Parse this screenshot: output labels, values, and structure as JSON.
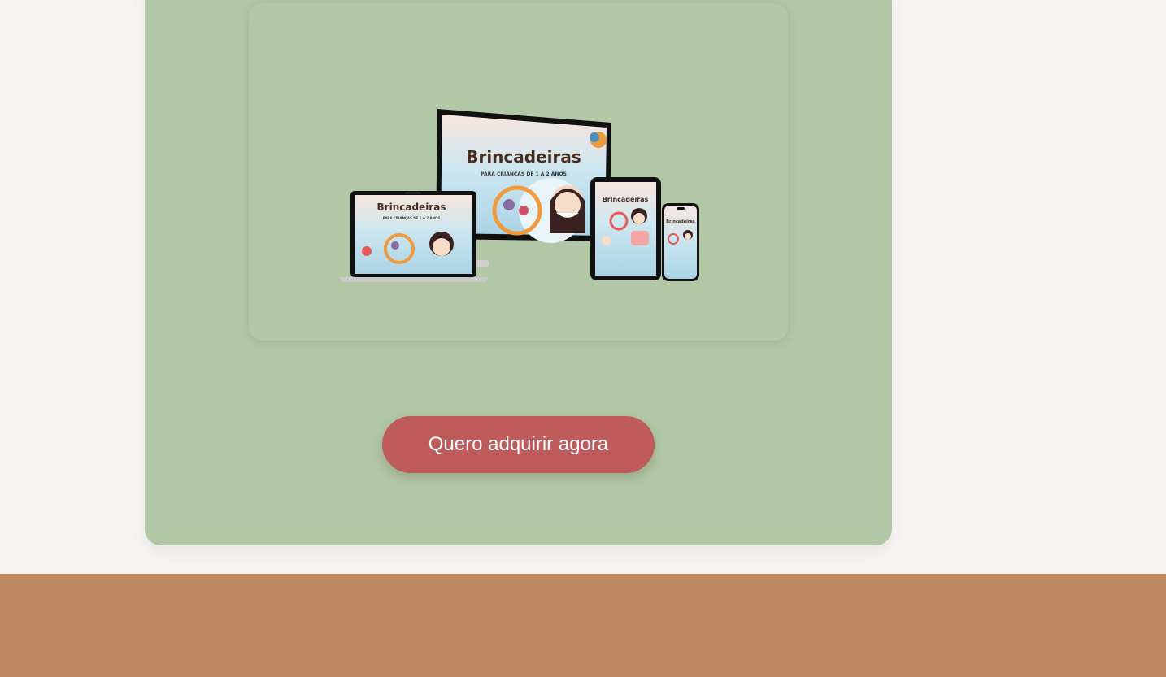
{
  "product": {
    "cover_title": "Brincadeiras",
    "cover_subtitle": "PARA CRIANÇAS DE 1 A 2 ANOS"
  },
  "cta": {
    "label": "Quero adquirir agora"
  },
  "colors": {
    "page_background": "#f8f4f3",
    "card_background": "#b2c7a5",
    "cta_background": "#c05b5b",
    "footer_background": "#bf8a62"
  }
}
